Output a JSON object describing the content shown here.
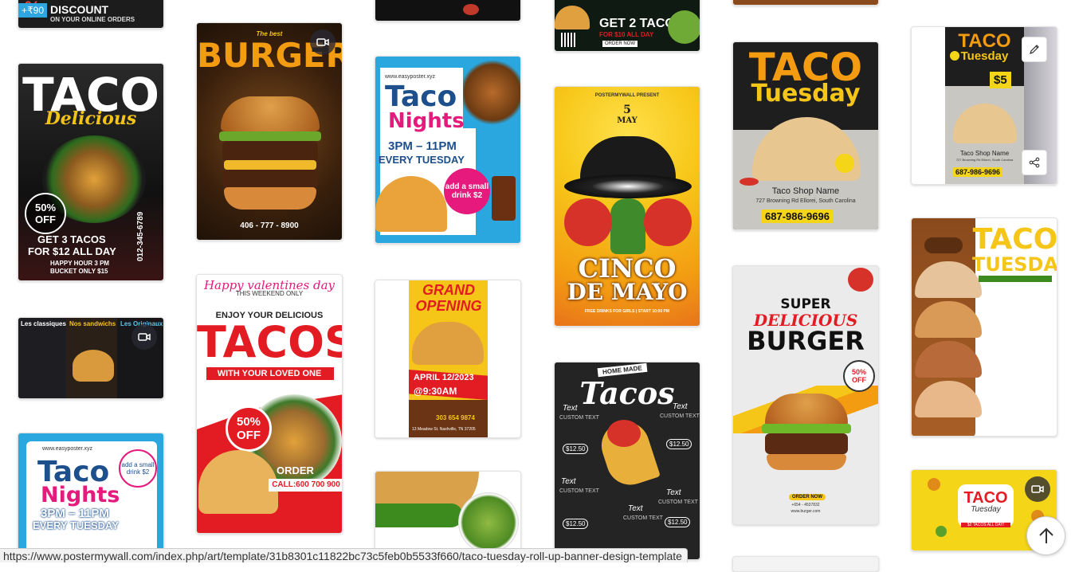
{
  "price_badge": "+₹90",
  "status_url": "https://www.postermywall.com/index.php/art/template/31b8301c11822bc73c5feb0b5533f660/taco-tuesday-roll-up-banner-design-template",
  "cards": {
    "top_discount": {
      "line1": "DISCOUNT",
      "line2": "ON YOUR ONLINE ORDERS"
    },
    "taco_delicious": {
      "title": "TACO",
      "sub": "Delicious",
      "badge": "50% OFF",
      "line1": "GET 3 TACOS",
      "line2": "FOR $12 ALL DAY",
      "line3": "HAPPY HOUR 3 PM",
      "line4": "BUCKET ONLY $15",
      "side": "012-345-6789"
    },
    "menu_board": {
      "h1": "Les classiques",
      "h2": "Nos sandwichs",
      "h3": "Les Originaux"
    },
    "taco_nights_1": {
      "url": "www.easyposter.xyz",
      "title1": "Taco",
      "title2": "Nights",
      "line1": "3PM – 11PM",
      "line2": "EVERY TUESDAY",
      "promo": "add a small drink $2"
    },
    "burger_1": {
      "small": "The best",
      "title": "BURGER",
      "phone": "406 - 777 - 8900"
    },
    "valentine": {
      "line1": "Happy valentines day",
      "line2": "THIS WEEKEND ONLY",
      "line3": "ENJOY YOUR DELICIOUS",
      "title": "TACOS",
      "line4": "WITH YOUR LOVED ONE",
      "badge": "50% OFF",
      "order": "ORDER NOW",
      "call": "CALL:600 700 900"
    },
    "taco_nights_2": {
      "url": "www.easyposter.xyz",
      "title1": "Taco",
      "title2": "Nights",
      "line1": "3PM – 11PM",
      "line2": "EVERY TUESDAY",
      "promo": "add a small drink $2"
    },
    "grand_opening": {
      "title1": "GRAND",
      "title2": "OPENING",
      "date": "APRIL 12/2023",
      "time": "@9:30AM",
      "phone": "303 654 9874",
      "address": "13 Meadow St. Nashville, TN 37205"
    },
    "get2tacos": {
      "line1": "GET 2 TACOS",
      "line2": "FOR $10 ALL DAY",
      "cta": "ORDER NOW"
    },
    "cinco": {
      "top": "POSTERMYWALL PRESENT",
      "day": "5",
      "month": "MAY",
      "title1": "CINCO",
      "title2": "DE MAYO",
      "foot": "FREE DRINKS FOR GIRLS | START 10:00 PM"
    },
    "chalk_tacos": {
      "top": "HOME MADE",
      "title": "Tacos",
      "item": "Text",
      "custom": "CUSTOM TEXT",
      "price": "$12.50"
    },
    "taco_tuesday_1": {
      "title1": "TACO",
      "title2": "Tuesday",
      "shop": "Taco Shop Name",
      "address": "727 Browning Rd Ellorei, South Carolina",
      "phone": "687-986-9696"
    },
    "super_burger": {
      "line1": "SUPER",
      "line2": "DELICIOUS",
      "title": "BURGER",
      "badge": "50% OFF",
      "cta": "ORDER NOW",
      "phone": "+654 - 4537832",
      "url": "www.burger.com"
    },
    "taco_tuesday_selected": {
      "title1": "TACO",
      "title2": "Tuesday",
      "price": "$5",
      "shop": "Taco Shop Name",
      "address": "727 Browning Rd Ellorei, South Carolina",
      "phone": "687-986-9696"
    },
    "taco_tuesday_banner": {
      "title1": "TACO",
      "title2": "TUESDAY"
    },
    "taco_tuesday_video": {
      "title1": "TACO",
      "title2": "Tuesday",
      "sub": "$2 TACOS ALL DAY!"
    }
  },
  "icons": {
    "video": "video-camera-icon",
    "edit": "pencil-icon",
    "share": "share-icon",
    "scroll_top": "arrow-up-icon"
  },
  "colors": {
    "accent": "#2ea6e0",
    "taco_orange": "#f39c12",
    "red": "#e31b23"
  }
}
